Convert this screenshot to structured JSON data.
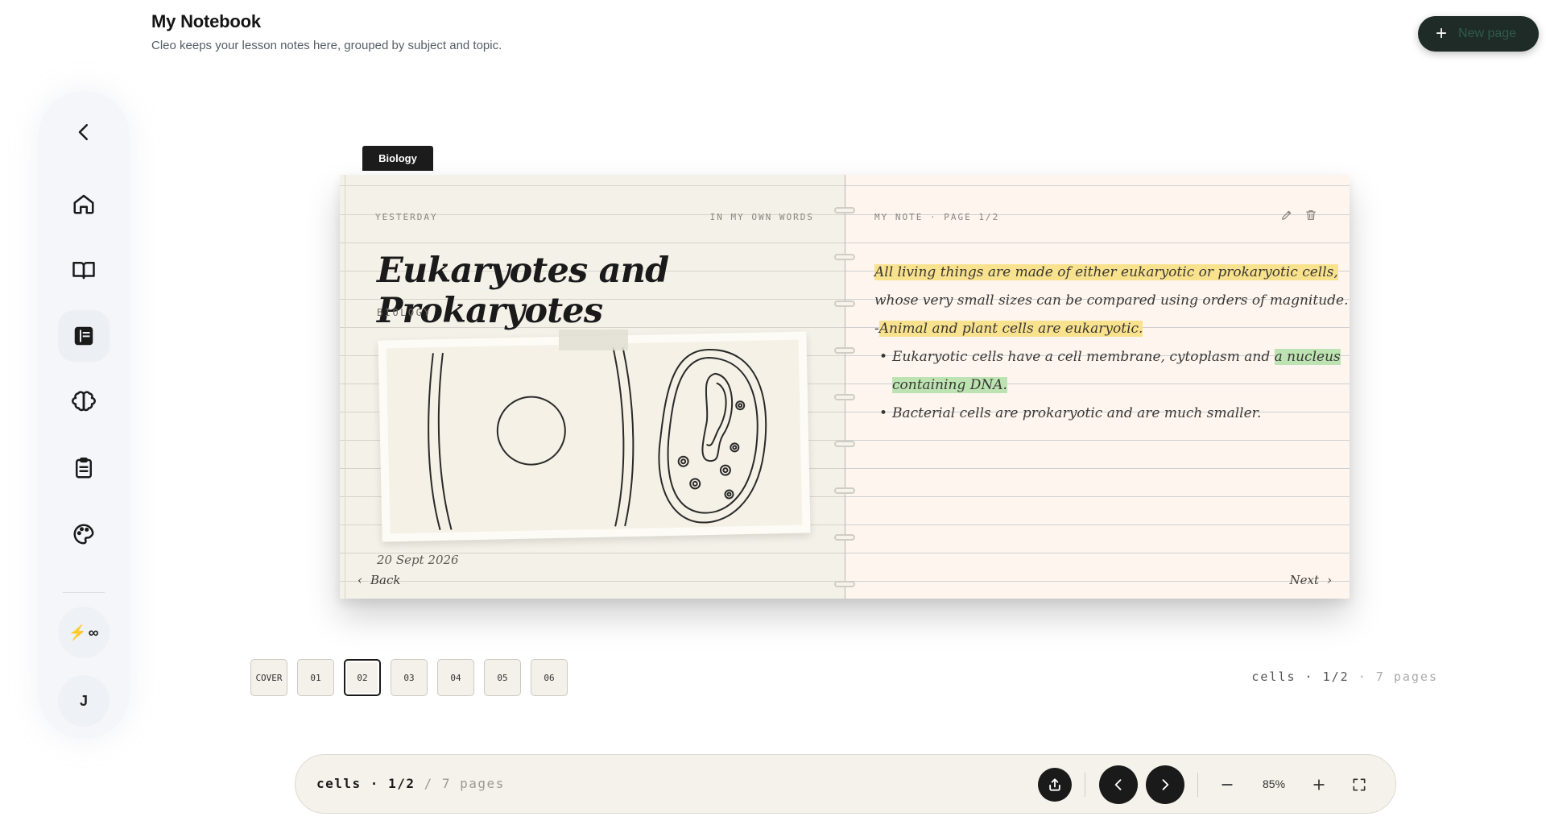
{
  "header": {
    "title": "My Notebook",
    "subtitle": "Cleo keeps your lesson notes here, grouped by subject and topic.",
    "new_page_label": "New page"
  },
  "sidebar": {
    "items": [
      {
        "name": "collapse",
        "icon": "chevron-left-icon"
      },
      {
        "name": "home",
        "icon": "home-icon"
      },
      {
        "name": "library",
        "icon": "book-open-icon"
      },
      {
        "name": "notebook",
        "icon": "notebook-icon",
        "active": true
      },
      {
        "name": "brain",
        "icon": "brain-icon"
      },
      {
        "name": "tasks",
        "icon": "clipboard-icon"
      },
      {
        "name": "themes",
        "icon": "palette-icon"
      }
    ],
    "energy_label": "∞",
    "avatar_initial": "J"
  },
  "notebook": {
    "subject_tab": "Biology",
    "left_page": {
      "when": "YESTERDAY",
      "kind": "IN MY OWN WORDS",
      "title": "Eukaryotes and Prokaryotes",
      "subject": "BIOLOGY",
      "date": "20 Sept 2026",
      "back_label": "Back"
    },
    "right_page": {
      "header": "MY NOTE · PAGE 1/2",
      "lines": {
        "l1": "All living things are made of either eukaryotic or prokaryotic cells,",
        "l2": "whose very small sizes can be compared using orders of magnitude.",
        "l3_prefix": "-",
        "l3": "Animal and plant cells are eukaryotic.",
        "l4a": "Eukaryotic cells have a cell membrane, cytoplasm and ",
        "l4b": "a nucleus",
        "l5": "containing DNA.",
        "l6": "Bacterial cells are prokaryotic and are much smaller."
      },
      "next_label": "Next"
    }
  },
  "page_tabs": [
    "COVER",
    "01",
    "02",
    "03",
    "04",
    "05",
    "06"
  ],
  "active_tab": "02",
  "page_status": {
    "topic": "cells",
    "position": "1/2",
    "total": "7 pages"
  },
  "toolbar": {
    "topic": "cells",
    "position": "1/2",
    "total": "/ 7 pages",
    "zoom": "85%"
  },
  "colors": {
    "highlight_yellow": "#f9e28e",
    "highlight_green": "#bde3b3",
    "accent_dark": "#1a1a1a",
    "bolt": "#f0b223"
  }
}
